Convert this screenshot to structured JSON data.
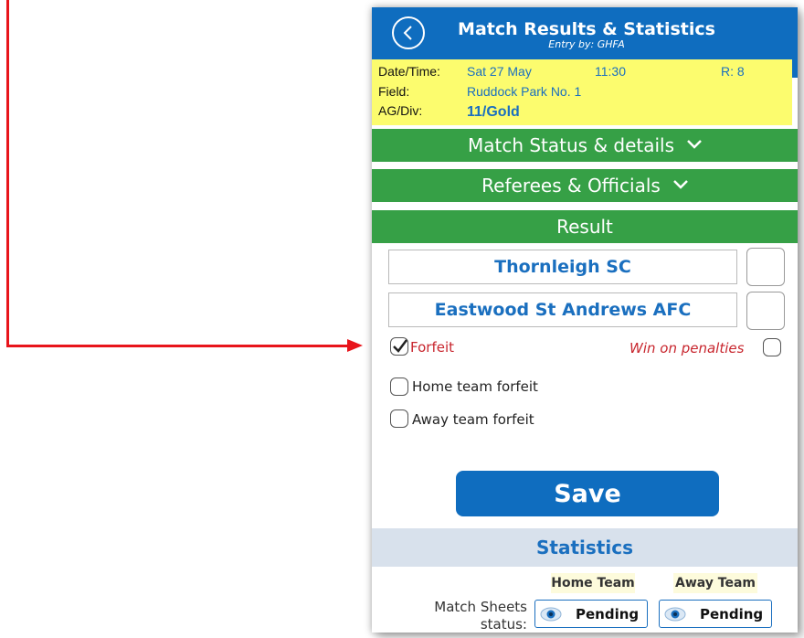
{
  "header": {
    "title": "Match Results & Statistics",
    "subtitle": "Entry by: GHFA",
    "back_icon": "chevron-left-icon"
  },
  "info": {
    "datetime_label": "Date/Time:",
    "date": "Sat 27 May",
    "time": "11:30",
    "round": "R: 8",
    "field_label": "Field:",
    "field": "Ruddock Park No. 1",
    "agdiv_label": "AG/Div:",
    "agdiv": "11/Gold"
  },
  "sections": {
    "match_status": "Match Status & details",
    "referees": "Referees & Officials",
    "result": "Result"
  },
  "teams": {
    "home": "Thornleigh SC",
    "away": "Eastwood St Andrews AFC",
    "home_score": "",
    "away_score": ""
  },
  "options": {
    "forfeit": "Forfeit",
    "forfeit_checked": true,
    "win_on_penalties": "Win on penalties",
    "home_forfeit": "Home team forfeit",
    "away_forfeit": "Away team forfeit"
  },
  "save_label": "Save",
  "statistics": {
    "title": "Statistics",
    "home_team": "Home Team",
    "away_team": "Away Team",
    "match_sheets_label": "Match Sheets status:",
    "home_status": "Pending",
    "away_status": "Pending"
  },
  "colors": {
    "header": "#0f6dbf",
    "info_bg": "#fcfc6e",
    "section_bar": "#36a046",
    "accent_red": "#c8262e",
    "stats_bar": "#d8e1ec"
  }
}
